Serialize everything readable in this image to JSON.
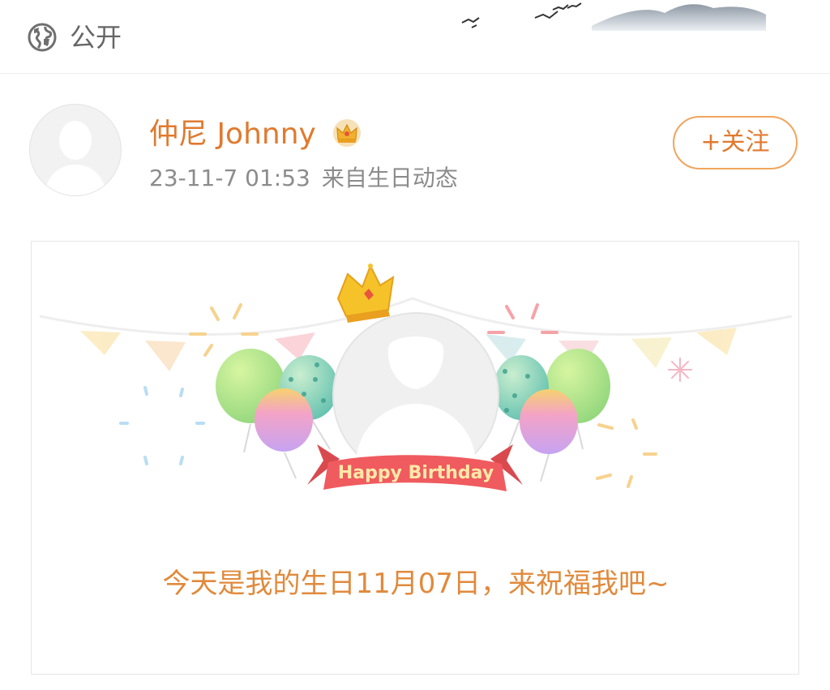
{
  "header": {
    "visibility_icon": "globe-icon",
    "visibility_label": "公开"
  },
  "post": {
    "author_name": "仲尼 Johnny",
    "author_badge_icon": "crown-badge-icon",
    "timestamp": "23-11-7 01:53",
    "source": "来自生日动态",
    "follow_label": "+关注"
  },
  "card": {
    "ribbon_text": "Happy Birthday",
    "message": "今天是我的生日11月07日，来祝福我吧~"
  },
  "colors": {
    "accent": "#e07a2f",
    "meta_text": "#8c8c8c",
    "ribbon": "#ef5b5f",
    "follow_border": "#f0a55d"
  }
}
